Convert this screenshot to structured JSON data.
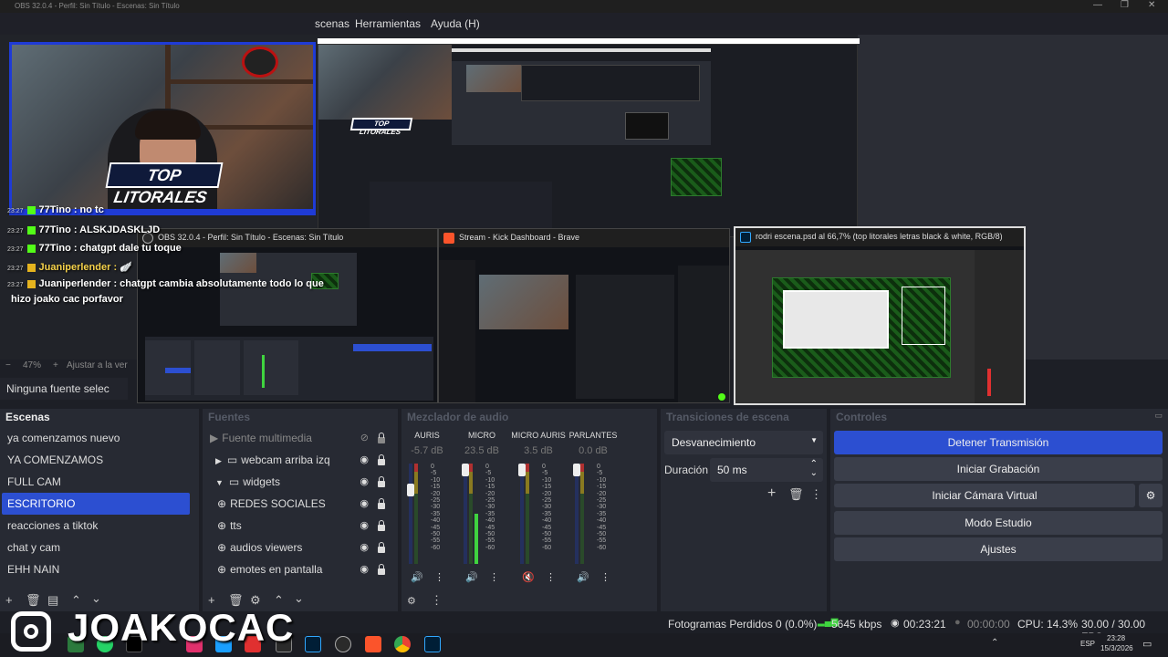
{
  "window": {
    "title": "OBS 32.0.4 - Perfil: Sin Título - Escenas: Sin Título",
    "controls": [
      "—",
      "❐",
      "✕"
    ]
  },
  "menu": [
    {
      "label": "scenas"
    },
    {
      "label": "Herramientas"
    },
    {
      "label": "Ayuda (H)"
    }
  ],
  "overlay": {
    "logo_text": "TOP LITORALES",
    "chat": [
      {
        "time": "23:27",
        "badge": "green",
        "text": "77Tino : no tc"
      },
      {
        "time": "23:27",
        "badge": "green",
        "text": "77Tino : ALSKJDASKLJD"
      },
      {
        "time": "23:27",
        "badge": "green",
        "text": "77Tino : chatgpt dale tu toque"
      },
      {
        "time": "23:27",
        "badge": "gold",
        "text": "Juaniperlender : 🪽"
      },
      {
        "time": "23:27",
        "badge": "gold",
        "text": "Juaniperlender : chatgpt cambia absolutamente todo lo que"
      },
      {
        "time": "",
        "badge": "",
        "text": "hizo joako cac porfavor"
      }
    ],
    "brand_name": "JOAKOCAC"
  },
  "thumbnails": {
    "obs": "OBS 32.0.4 - Perfil: Sin Título - Escenas: Sin Título",
    "brave": "Stream - Kick Dashboard - Brave",
    "ps": "rodri escena.psd al 66,7% (top litorales letras black & white, RGB/8)"
  },
  "preview_bar": {
    "zoom": "47%",
    "fit": "Ajustar a la ver"
  },
  "no_source": "Ninguna fuente selec",
  "scenes": {
    "title": "Escenas",
    "items": [
      "ya comenzamos nuevo",
      "YA COMENZAMOS",
      "FULL CAM",
      "ESCRITORIO",
      "reacciones a tiktok",
      "chat y cam",
      "EHH NAIN"
    ],
    "selected": 3
  },
  "sources": {
    "title": "Fuentes",
    "items": [
      {
        "label": "Fuente multimedia",
        "dim": true
      },
      {
        "label": "webcam arriba izq"
      },
      {
        "label": "widgets"
      },
      {
        "label": "REDES SOCIALES"
      },
      {
        "label": "tts"
      },
      {
        "label": "audios viewers"
      },
      {
        "label": "emotes en pantalla"
      }
    ]
  },
  "mixer": {
    "title": "Mezclador de audio",
    "ticks": [
      "0",
      "-5",
      "-10",
      "-15",
      "-20",
      "-25",
      "-30",
      "-35",
      "-40",
      "-45",
      "-50",
      "-55",
      "-60"
    ],
    "channels": [
      {
        "name": "AURIS",
        "db": "-5.7 dB",
        "level_fraction": 0.0,
        "muted": false
      },
      {
        "name": "MICRO",
        "db": "23.5 dB",
        "level_fraction": 0.5,
        "muted": false
      },
      {
        "name": "MICRO AURIS",
        "db": "3.5 dB",
        "level_fraction": 0.0,
        "muted": true
      },
      {
        "name": "PARLANTES",
        "db": "0.0 dB",
        "level_fraction": 0.0,
        "muted": false
      }
    ]
  },
  "transitions": {
    "title": "Transiciones de escena",
    "selected": "Desvanecimiento",
    "duration_label": "Duración",
    "duration_value": "50 ms"
  },
  "controls": {
    "title": "Controles",
    "buttons": [
      "Detener Transmisión",
      "Iniciar Grabación",
      "Iniciar Cámara Virtual",
      "Modo Estudio",
      "Ajustes"
    ]
  },
  "status": {
    "dropped": "Fotogramas Perdidos 0 (0.0%)",
    "bitrate": "5645 kbps",
    "stream_time": "00:23:21",
    "rec_time": "00:00:00",
    "cpu": "CPU: 14.3%",
    "fps": "30.00 / 30.00 FPS"
  },
  "taskbar": {
    "lang": "ESP",
    "time": "23:28",
    "date": "15/3/2026"
  },
  "colors": {
    "accent": "#2c4fd1",
    "panel": "#272a33",
    "meter_green": "#3fd43f"
  }
}
